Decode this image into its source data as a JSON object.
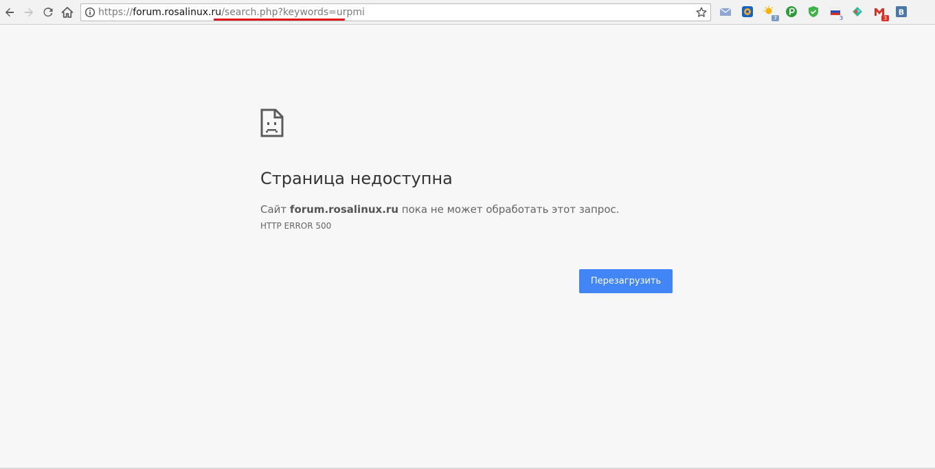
{
  "browser": {
    "url": {
      "scheme": "https://",
      "host": "forum.rosalinux.ru",
      "path": "/search.php?keywords=urpmi"
    },
    "extensions": [
      {
        "name": "mail-icon",
        "badge": ""
      },
      {
        "name": "mail-ru-agent-icon",
        "badge": ""
      },
      {
        "name": "weather-icon",
        "badge": "7"
      },
      {
        "name": "pocket-icon",
        "badge": ""
      },
      {
        "name": "shield-icon",
        "badge": ""
      },
      {
        "name": "flag-icon",
        "badge": "3"
      },
      {
        "name": "puzzle-icon",
        "badge": ""
      },
      {
        "name": "gmail-icon",
        "badge": "3"
      },
      {
        "name": "vk-icon",
        "badge": ""
      }
    ]
  },
  "error_page": {
    "title": "Страница недоступна",
    "desc_prefix": "Сайт ",
    "desc_host": "forum.rosalinux.ru",
    "desc_suffix": " пока не может обработать этот запрос.",
    "error_code": "HTTP ERROR 500",
    "reload_label": "Перезагрузить"
  },
  "colors": {
    "accent": "#4285f4",
    "underline": "#e0141e"
  }
}
